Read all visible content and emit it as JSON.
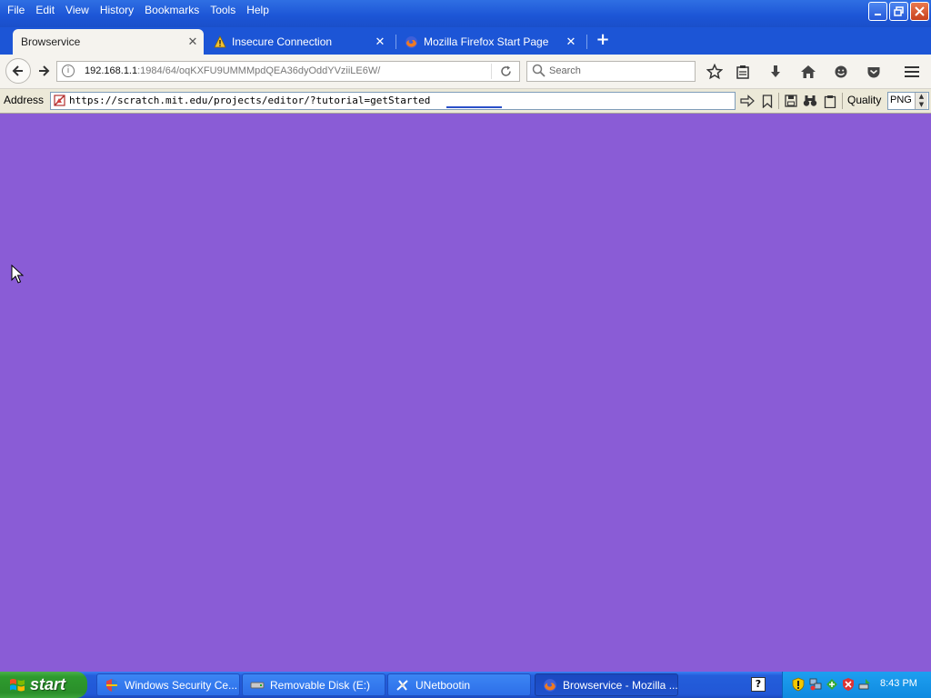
{
  "menu": {
    "items": [
      {
        "label": "File"
      },
      {
        "label": "Edit"
      },
      {
        "label": "View"
      },
      {
        "label": "History"
      },
      {
        "label": "Bookmarks"
      },
      {
        "label": "Tools"
      },
      {
        "label": "Help"
      }
    ]
  },
  "tabs": [
    {
      "label": "Browservice",
      "active": true
    },
    {
      "label": "Insecure Connection",
      "active": false,
      "icon": "warning-icon"
    },
    {
      "label": "Mozilla Firefox Start Page",
      "active": false,
      "icon": "firefox-icon"
    }
  ],
  "navbar": {
    "url_host": "192.168.1.1",
    "url_rest": ":1984/64/oqKXFU9UMMMpdQEA36dyOddYVziiLE6W/",
    "search_placeholder": "Search"
  },
  "addressbar": {
    "label": "Address",
    "url": "https://scratch.mit.edu/projects/editor/?tutorial=getStarted",
    "quality_label": "Quality",
    "quality_value": "PNG"
  },
  "content": {
    "background": "#8a5cd6"
  },
  "taskbar": {
    "start_label": "start",
    "tasks": [
      {
        "label": "Windows Security Ce...",
        "icon": "shield-icon",
        "active": false
      },
      {
        "label": "Removable Disk (E:)",
        "icon": "drive-icon",
        "active": false
      },
      {
        "label": "UNetbootin",
        "icon": "unetbootin-icon",
        "active": false
      },
      {
        "label": "Browservice - Mozilla ...",
        "icon": "firefox-icon",
        "active": true
      }
    ],
    "clock": "8:43 PM"
  },
  "colors": {
    "xp_blue": "#1c55d6",
    "start_green": "#2e9a2e",
    "tray_blue": "#0f8ae0"
  }
}
